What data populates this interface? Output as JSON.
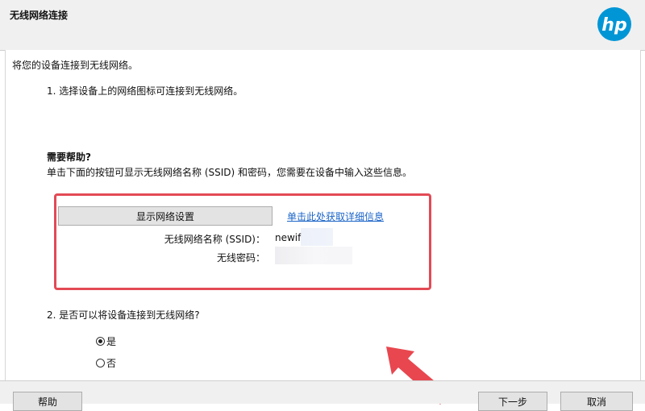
{
  "window": {
    "title": "无线网络连接"
  },
  "logo": {
    "text": "hp",
    "color": "#0096d6"
  },
  "content": {
    "intro": "将您的设备连接到无线网络。",
    "step1": "1. 选择设备上的网络图标可连接到无线网络。",
    "help_heading": "需要帮助?",
    "help_desc": "单击下面的按钮可显示无线网络名称 (SSID) 和密码，您需要在设备中输入这些信息。",
    "show_settings_label": "显示网络设置",
    "details_link": "单击此处获取详细信息",
    "ssid_label": "无线网络名称 (SSID)：",
    "ssid_value": "newif",
    "password_label": "无线密码：",
    "step2": "2. 是否可以将设备连接到无线网络?",
    "radio_yes": "是",
    "radio_no": "否"
  },
  "footer": {
    "help_label": "帮助",
    "next_label": "下一步",
    "cancel_label": "取消"
  },
  "colors": {
    "highlight": "#e34a55",
    "link": "#1a64c8",
    "arrow": "#e8474f"
  }
}
